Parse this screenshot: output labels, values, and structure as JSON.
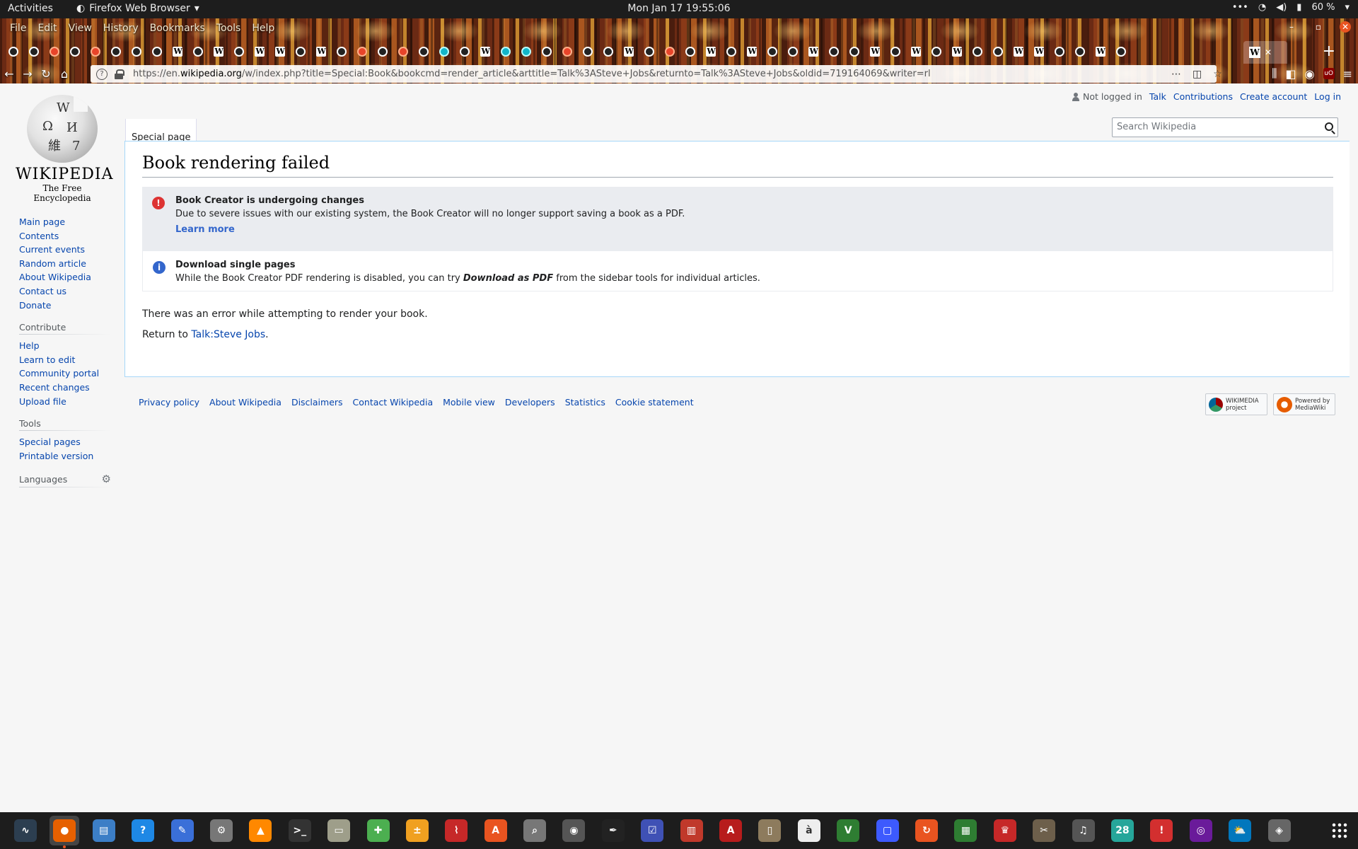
{
  "topbar": {
    "activities": "Activities",
    "app_name": "Firefox Web Browser",
    "clock": "Mon Jan 17  19:55:06",
    "battery": "60 %"
  },
  "firefox": {
    "menu": [
      "File",
      "Edit",
      "View",
      "History",
      "Bookmarks",
      "Tools",
      "Help"
    ],
    "url_prefix": "https://en.",
    "url_host": "wikipedia.org",
    "url_rest": "/w/index.php?title=Special:Book&bookcmd=render_article&arttitle=Talk%3ASteve+Jobs&returnto=Talk%3ASteve+Jobs&oldid=719164069&writer=rl",
    "url_more": "⋯",
    "tab_icons": [
      "github",
      "github",
      "orange",
      "google",
      "orange",
      "github",
      "github",
      "github",
      "wiki",
      "github",
      "wiki",
      "github",
      "wiki",
      "wiki",
      "github",
      "wiki",
      "github",
      "orange",
      "github",
      "orange",
      "github",
      "cyan",
      "github",
      "wiki",
      "cyan",
      "cyan",
      "github",
      "orange",
      "github",
      "github",
      "wiki",
      "github",
      "orange",
      "github",
      "wiki",
      "github",
      "wiki",
      "github",
      "github",
      "wiki",
      "github",
      "github",
      "wiki",
      "github",
      "wiki",
      "github",
      "wiki",
      "github",
      "github",
      "wiki",
      "wiki",
      "github",
      "github",
      "wiki",
      "github"
    ]
  },
  "wiki": {
    "logo_wordmark": "WIKIPEDIA",
    "logo_tagline": "The Free Encyclopedia",
    "nav": [
      "Main page",
      "Contents",
      "Current events",
      "Random article",
      "About Wikipedia",
      "Contact us",
      "Donate"
    ],
    "contribute_heading": "Contribute",
    "contribute": [
      "Help",
      "Learn to edit",
      "Community portal",
      "Recent changes",
      "Upload file"
    ],
    "tools_heading": "Tools",
    "tools": [
      "Special pages",
      "Printable version"
    ],
    "languages_heading": "Languages",
    "personal": {
      "not_logged_in": "Not logged in",
      "talk": "Talk",
      "contributions": "Contributions",
      "create_account": "Create account",
      "log_in": "Log in"
    },
    "namespace_tab": "Special page",
    "search_placeholder": "Search Wikipedia",
    "heading": "Book rendering failed",
    "notice1": {
      "title": "Book Creator is undergoing changes",
      "body": "Due to severe issues with our existing system, the Book Creator will no longer support saving a book as a PDF.",
      "link": "Learn more"
    },
    "notice2": {
      "title": "Download single pages",
      "body_before": "While the Book Creator PDF rendering is disabled, you can try ",
      "body_em": "Download as PDF",
      "body_after": " from the sidebar tools for individual articles."
    },
    "error_text": "There was an error while attempting to render your book.",
    "return_prefix": "Return to ",
    "return_link": "Talk:Steve Jobs",
    "return_suffix": ".",
    "footer": [
      "Privacy policy",
      "About Wikipedia",
      "Disclaimers",
      "Contact Wikipedia",
      "Mobile view",
      "Developers",
      "Statistics",
      "Cookie statement"
    ],
    "badge_wikimedia": "WIKIMEDIA\nproject",
    "badge_mediawiki": "Powered by\nMediaWiki"
  },
  "dock": {
    "apps": [
      {
        "icon": "system-monitor-icon",
        "color": "#2c3e50",
        "glyph": "∿"
      },
      {
        "icon": "firefox-icon",
        "color": "#e66000",
        "glyph": "●",
        "active": true
      },
      {
        "icon": "document-viewer-icon",
        "color": "#3c7ec6",
        "glyph": "▤"
      },
      {
        "icon": "help-icon",
        "color": "#1e88e5",
        "glyph": "?"
      },
      {
        "icon": "text-editor-icon",
        "color": "#3a6fd8",
        "glyph": "✎"
      },
      {
        "icon": "settings-icon",
        "color": "#777",
        "glyph": "⚙"
      },
      {
        "icon": "vlc-icon",
        "color": "#ff8800",
        "glyph": "▲"
      },
      {
        "icon": "terminal-icon",
        "color": "#333",
        "glyph": ">_"
      },
      {
        "icon": "files-icon",
        "color": "#9e9e8a",
        "glyph": "▭"
      },
      {
        "icon": "extensions-icon",
        "color": "#4caf50",
        "glyph": "✚"
      },
      {
        "icon": "calculator-icon",
        "color": "#f0a020",
        "glyph": "±"
      },
      {
        "icon": "sysmon-graph-icon",
        "color": "#c62828",
        "glyph": "⌇"
      },
      {
        "icon": "software-center-icon",
        "color": "#e95420",
        "glyph": "A"
      },
      {
        "icon": "image-viewer-icon",
        "color": "#777",
        "glyph": "⌕"
      },
      {
        "icon": "disk-usage-icon",
        "color": "#555",
        "glyph": "◉"
      },
      {
        "icon": "inkscape-icon",
        "color": "#222",
        "glyph": "✒"
      },
      {
        "icon": "tasks-icon",
        "color": "#3f51b5",
        "glyph": "☑"
      },
      {
        "icon": "document-scanner-icon",
        "color": "#c0392b",
        "glyph": "▥"
      },
      {
        "icon": "pdf-reader-icon",
        "color": "#b71c1c",
        "glyph": "A"
      },
      {
        "icon": "archive-manager-icon",
        "color": "#8d7b5d",
        "glyph": "▯"
      },
      {
        "icon": "character-map-icon",
        "color": "#eee",
        "glyph": "à"
      },
      {
        "icon": "vim-icon",
        "color": "#2e7d32",
        "glyph": "V"
      },
      {
        "icon": "remote-desktop-icon",
        "color": "#3d5afe",
        "glyph": "▢"
      },
      {
        "icon": "update-manager-icon",
        "color": "#e95420",
        "glyph": "↻"
      },
      {
        "icon": "spreadsheet-icon",
        "color": "#2e7d32",
        "glyph": "▦"
      },
      {
        "icon": "mario-game-icon",
        "color": "#c62828",
        "glyph": "♛"
      },
      {
        "icon": "gimp-icon",
        "color": "#6d5f4b",
        "glyph": "✂"
      },
      {
        "icon": "music-player-icon",
        "color": "#555",
        "glyph": "♫"
      },
      {
        "icon": "calendar-icon",
        "color": "#26a69a",
        "glyph": "28"
      },
      {
        "icon": "error-reporter-icon",
        "color": "#d32f2f",
        "glyph": "!"
      },
      {
        "icon": "screenshot-icon",
        "color": "#6a1b9a",
        "glyph": "◎"
      },
      {
        "icon": "weather-icon",
        "color": "#0277bd",
        "glyph": "⛅"
      },
      {
        "icon": "disks-icon",
        "color": "#666",
        "glyph": "◈"
      }
    ]
  }
}
